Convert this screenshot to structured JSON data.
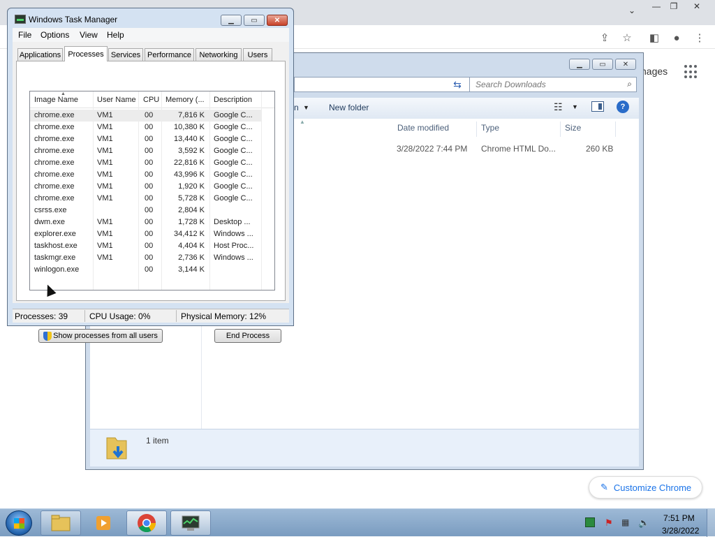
{
  "chrome": {
    "images_label": "nages",
    "customize_label": "Customize Chrome"
  },
  "explorer": {
    "search_placeholder": "Search Downloads",
    "cmd_new_folder": "New folder",
    "cmd_truncated": "n",
    "columns": [
      "Date modified",
      "Type",
      "Size"
    ],
    "file": {
      "date": "3/28/2022 7:44 PM",
      "type": "Chrome HTML Do...",
      "size": "260 KB"
    },
    "item_count": "1 item"
  },
  "taskmgr": {
    "title": "Windows Task Manager",
    "menu": [
      "File",
      "Options",
      "View",
      "Help"
    ],
    "tabs": [
      "Applications",
      "Processes",
      "Services",
      "Performance",
      "Networking",
      "Users"
    ],
    "active_tab": "Processes",
    "columns": [
      "Image Name",
      "User Name",
      "CPU",
      "Memory (...",
      "Description"
    ],
    "processes": [
      {
        "name": "chrome.exe",
        "user": "VM1",
        "cpu": "00",
        "mem": "7,816 K",
        "desc": "Google C..."
      },
      {
        "name": "chrome.exe",
        "user": "VM1",
        "cpu": "00",
        "mem": "10,380 K",
        "desc": "Google C..."
      },
      {
        "name": "chrome.exe",
        "user": "VM1",
        "cpu": "00",
        "mem": "13,440 K",
        "desc": "Google C..."
      },
      {
        "name": "chrome.exe",
        "user": "VM1",
        "cpu": "00",
        "mem": "3,592 K",
        "desc": "Google C..."
      },
      {
        "name": "chrome.exe",
        "user": "VM1",
        "cpu": "00",
        "mem": "22,816 K",
        "desc": "Google C..."
      },
      {
        "name": "chrome.exe",
        "user": "VM1",
        "cpu": "00",
        "mem": "43,996 K",
        "desc": "Google C..."
      },
      {
        "name": "chrome.exe",
        "user": "VM1",
        "cpu": "00",
        "mem": "1,920 K",
        "desc": "Google C..."
      },
      {
        "name": "chrome.exe",
        "user": "VM1",
        "cpu": "00",
        "mem": "5,728 K",
        "desc": "Google C..."
      },
      {
        "name": "csrss.exe",
        "user": "",
        "cpu": "00",
        "mem": "2,804 K",
        "desc": ""
      },
      {
        "name": "dwm.exe",
        "user": "VM1",
        "cpu": "00",
        "mem": "1,728 K",
        "desc": "Desktop ..."
      },
      {
        "name": "explorer.exe",
        "user": "VM1",
        "cpu": "00",
        "mem": "34,412 K",
        "desc": "Windows ..."
      },
      {
        "name": "taskhost.exe",
        "user": "VM1",
        "cpu": "00",
        "mem": "4,404 K",
        "desc": "Host Proc..."
      },
      {
        "name": "taskmgr.exe",
        "user": "VM1",
        "cpu": "00",
        "mem": "2,736 K",
        "desc": "Windows ..."
      },
      {
        "name": "winlogon.exe",
        "user": "",
        "cpu": "00",
        "mem": "3,144 K",
        "desc": ""
      }
    ],
    "show_all_label": "Show processes from all users",
    "end_process_label": "End Process",
    "status": {
      "processes": "Processes: 39",
      "cpu": "CPU Usage: 0%",
      "memory": "Physical Memory: 12%"
    }
  },
  "taskbar": {
    "time": "7:51 PM",
    "date": "3/28/2022"
  }
}
